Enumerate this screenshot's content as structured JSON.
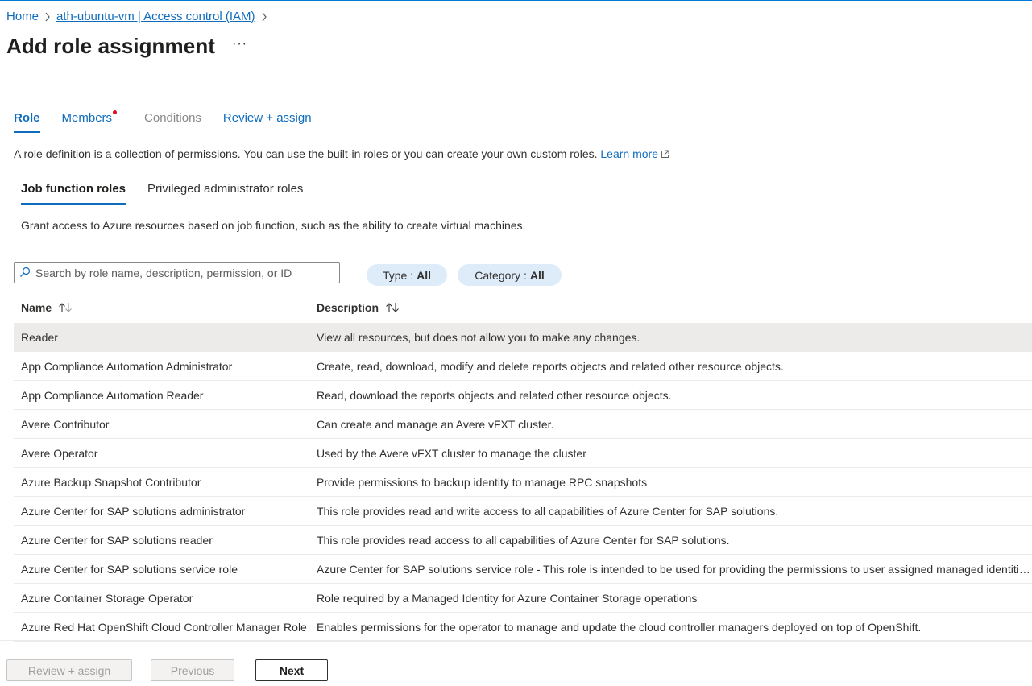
{
  "breadcrumb": {
    "home": "Home",
    "parent": "ath-ubuntu-vm | Access control (IAM)"
  },
  "page": {
    "title": "Add role assignment",
    "more": "···"
  },
  "tabs": [
    {
      "label": "Role"
    },
    {
      "label": "Members"
    },
    {
      "label": "Conditions"
    },
    {
      "label": "Review + assign"
    }
  ],
  "description": {
    "text": "A role definition is a collection of permissions. You can use the built-in roles or you can create your own custom roles.",
    "link": "Learn more"
  },
  "subtabs": [
    {
      "label": "Job function roles"
    },
    {
      "label": "Privileged administrator roles"
    }
  ],
  "grant_text": "Grant access to Azure resources based on job function, such as the ability to create virtual machines.",
  "search": {
    "placeholder": "Search by role name, description, permission, or ID",
    "value": ""
  },
  "filters": {
    "type_label": "Type :",
    "type_value": "All",
    "category_label": "Category :",
    "category_value": "All"
  },
  "table": {
    "col_name": "Name",
    "col_desc": "Description",
    "rows": [
      {
        "name": "Reader",
        "desc": "View all resources, but does not allow you to make any changes."
      },
      {
        "name": "App Compliance Automation Administrator",
        "desc": "Create, read, download, modify and delete reports objects and related other resource objects."
      },
      {
        "name": "App Compliance Automation Reader",
        "desc": "Read, download the reports objects and related other resource objects."
      },
      {
        "name": "Avere Contributor",
        "desc": "Can create and manage an Avere vFXT cluster."
      },
      {
        "name": "Avere Operator",
        "desc": "Used by the Avere vFXT cluster to manage the cluster"
      },
      {
        "name": "Azure Backup Snapshot Contributor",
        "desc": "Provide permissions to backup identity to manage RPC snapshots"
      },
      {
        "name": "Azure Center for SAP solutions administrator",
        "desc": "This role provides read and write access to all capabilities of Azure Center for SAP solutions."
      },
      {
        "name": "Azure Center for SAP solutions reader",
        "desc": "This role provides read access to all capabilities of Azure Center for SAP solutions."
      },
      {
        "name": "Azure Center for SAP solutions service role",
        "desc": "Azure Center for SAP solutions service role - This role is intended to be used for providing the permissions to user assigned managed identities"
      },
      {
        "name": "Azure Container Storage Operator",
        "desc": "Role required by a Managed Identity for Azure Container Storage operations"
      },
      {
        "name": "Azure Red Hat OpenShift Cloud Controller Manager Role",
        "desc": "Enables permissions for the operator to manage and update the cloud controller managers deployed on top of OpenShift."
      }
    ]
  },
  "footer": {
    "review_label": "Review + assign",
    "previous_label": "Previous",
    "next_label": "Next"
  },
  "colors": {
    "accent": "#0f6cbd",
    "selected_row": "#edebe9",
    "pill_bg": "#deecf9",
    "required_dot": "#e00b1c"
  }
}
